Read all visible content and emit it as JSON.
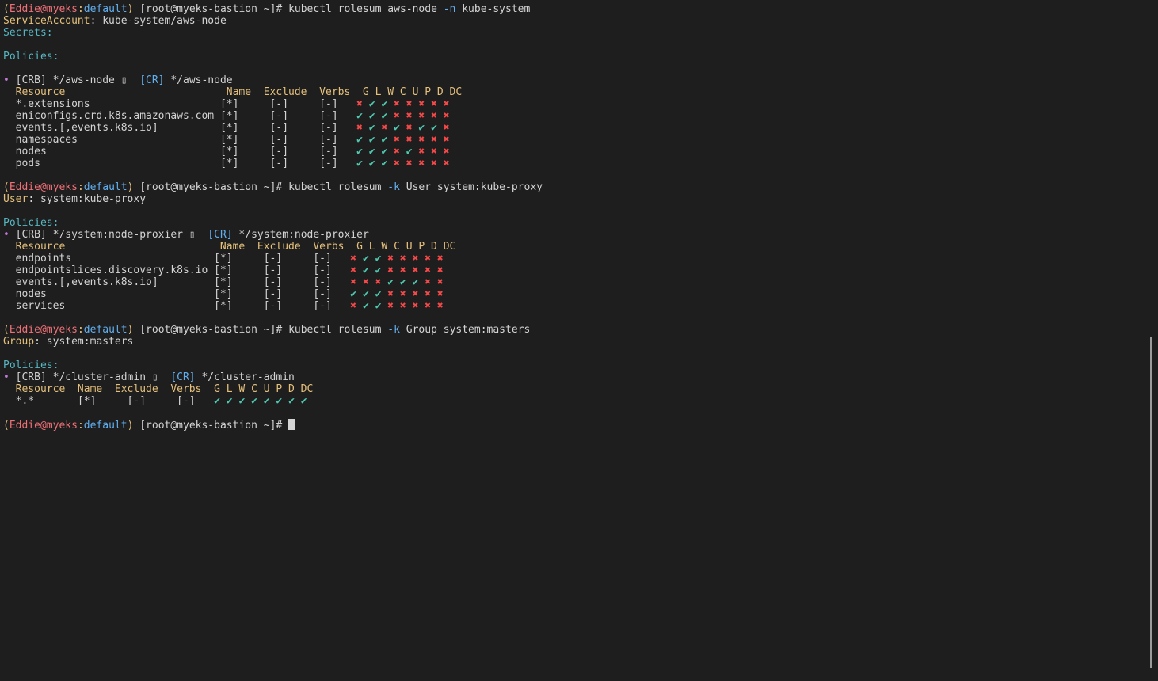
{
  "prompt": {
    "open": "(",
    "user": "Eddie",
    "at": "@",
    "host": "myeks",
    "colon": ":",
    "ctx": "default",
    "close": ")",
    "shell": " [root@myeks-bastion ~]# "
  },
  "block1": {
    "cmd_a": "kubectl rolesum aws-node ",
    "flag": "-n",
    "cmd_b": " kube-system",
    "sa_key": "ServiceAccount",
    "sa_val": ": kube-system/aws-node",
    "secrets_key": "Secrets:",
    "policies_key": "Policies:",
    "binding": "[CRB] */aws-node ▯  ",
    "cr_tag": "[CR]",
    "cr_val": " */aws-node",
    "header": "Resource                          Name  Exclude  Verbs  G L W C U P D DC",
    "rows": [
      {
        "res": "*.extensions                     ",
        "cols": "[*]     [-]     [-]   ",
        "perm": "✖✔✔✖✖✖✖✖"
      },
      {
        "res": "eniconfigs.crd.k8s.amazonaws.com ",
        "cols": "[*]     [-]     [-]   ",
        "perm": "✔✔✔✖✖✖✖✖"
      },
      {
        "res": "events.[,events.k8s.io]          ",
        "cols": "[*]     [-]     [-]   ",
        "perm": "✖✔✖✔✖✔✔✖"
      },
      {
        "res": "namespaces                       ",
        "cols": "[*]     [-]     [-]   ",
        "perm": "✔✔✔✖✖✖✖✖"
      },
      {
        "res": "nodes                            ",
        "cols": "[*]     [-]     [-]   ",
        "perm": "✔✔✔✖✔✖✖✖"
      },
      {
        "res": "pods                             ",
        "cols": "[*]     [-]     [-]   ",
        "perm": "✔✔✔✖✖✖✖✖"
      }
    ]
  },
  "block2": {
    "cmd_a": "kubectl rolesum ",
    "flag": "-k",
    "cmd_b": " User system:kube-proxy",
    "user_key": "User",
    "user_val": ": system:kube-proxy",
    "policies_key": "Policies:",
    "binding": "[CRB] */system:node-proxier ▯  ",
    "cr_tag": "[CR]",
    "cr_val": " */system:node-proxier",
    "header": "Resource                         Name  Exclude  Verbs  G L W C U P D DC",
    "rows": [
      {
        "res": "endpoints                       ",
        "cols": "[*]     [-]     [-]   ",
        "perm": "✖✔✔✖✖✖✖✖"
      },
      {
        "res": "endpointslices.discovery.k8s.io ",
        "cols": "[*]     [-]     [-]   ",
        "perm": "✖✔✔✖✖✖✖✖"
      },
      {
        "res": "events.[,events.k8s.io]         ",
        "cols": "[*]     [-]     [-]   ",
        "perm": "✖✖✖✔✔✔✖✖"
      },
      {
        "res": "nodes                           ",
        "cols": "[*]     [-]     [-]   ",
        "perm": "✔✔✔✖✖✖✖✖"
      },
      {
        "res": "services                        ",
        "cols": "[*]     [-]     [-]   ",
        "perm": "✖✔✔✖✖✖✖✖"
      }
    ]
  },
  "block3": {
    "cmd_a": "kubectl rolesum ",
    "flag": "-k",
    "cmd_b": " Group system:masters",
    "group_key": "Group",
    "group_val": ": system:masters",
    "policies_key": "Policies:",
    "binding": "[CRB] */cluster-admin ▯  ",
    "cr_tag": "[CR]",
    "cr_val": " */cluster-admin",
    "header": "Resource  Name  Exclude  Verbs  G L W C U P D DC",
    "rows": [
      {
        "res": "*.*       ",
        "cols": "[*]     [-]     [-]   ",
        "perm": "✔✔✔✔✔✔✔✔"
      }
    ]
  },
  "colors": {
    "background": "#1e1e1e",
    "yes": "#4ec9b0",
    "no": "#f44747",
    "header": "#e5c07b"
  }
}
